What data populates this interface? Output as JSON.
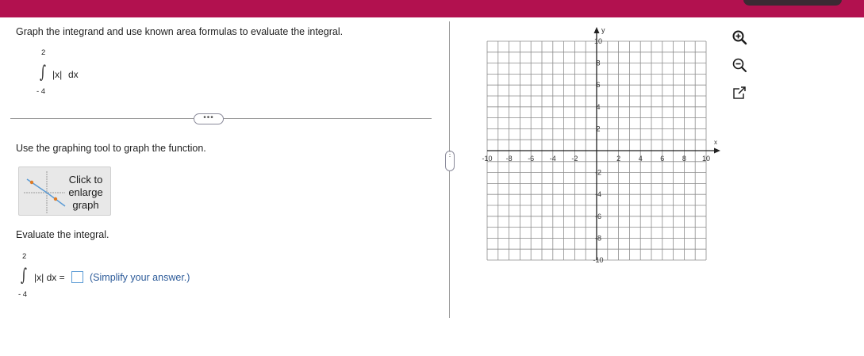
{
  "header": {
    "accent_color": "#b2114f"
  },
  "question": {
    "instruction": "Graph the integrand and use known area formulas to evaluate the integral.",
    "integral": {
      "upper": "2",
      "lower": "- 4",
      "integrand": "|x|",
      "dx": "dx"
    }
  },
  "more_button": {
    "label": "•••"
  },
  "graph_section": {
    "instruction": "Use the graphing tool to graph the function.",
    "enlarge_button": {
      "label": "Click to enlarge graph"
    }
  },
  "evaluate_section": {
    "instruction": "Evaluate the integral.",
    "integral": {
      "upper": "2",
      "lower": "- 4",
      "expression": "|x| dx ="
    },
    "answer_value": "",
    "hint": "(Simplify your answer.)"
  },
  "panel_toggle": {
    "label": "⋮"
  },
  "graph": {
    "x_axis_label": "x",
    "y_axis_label": "y",
    "x_range": [
      -10,
      10
    ],
    "y_range": [
      -10,
      10
    ],
    "grid_step": 1,
    "x_ticks": [
      "-10",
      "-8",
      "-6",
      "-4",
      "-2",
      "2",
      "4",
      "6",
      "8",
      "10"
    ],
    "y_ticks": [
      "10",
      "8",
      "6",
      "4",
      "2",
      "-2",
      "-4",
      "-6",
      "-8",
      "-10"
    ],
    "grid_color": "#8c8c8c",
    "axis_color": "#222222"
  },
  "tools": [
    {
      "name": "zoom-in-icon"
    },
    {
      "name": "zoom-out-icon"
    },
    {
      "name": "open-external-icon"
    }
  ]
}
